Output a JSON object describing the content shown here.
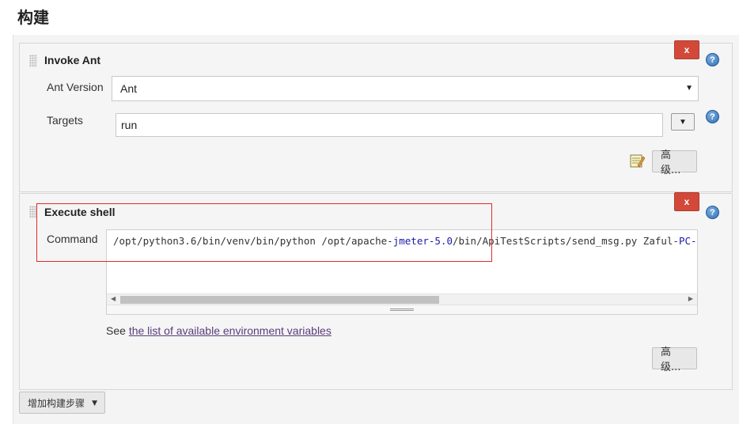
{
  "section": {
    "title": "构建"
  },
  "ant_step": {
    "title": "Invoke Ant",
    "delete_label": "x",
    "version_label": "Ant Version",
    "version_value": "Ant",
    "targets_label": "Targets",
    "targets_value": "run",
    "advanced_label": "高级..."
  },
  "shell_step": {
    "title": "Execute shell",
    "delete_label": "x",
    "command_label": "Command",
    "command_parts": {
      "p1": "/opt/python3.6/bin/venv/bin/python /opt/apache-",
      "p2": "jmeter-5.0",
      "p3": "/bin/ApiTestScripts/send_msg.py Zaful-",
      "p4": "PC-$country"
    },
    "env_prefix": "See ",
    "env_link": "the list of available environment variables",
    "advanced_label": "高级..."
  },
  "add_step": {
    "label": "增加构建步骤"
  },
  "colors": {
    "delete_red": "#d24939",
    "highlight": "#e02a2a",
    "link": "#5a3d7a"
  },
  "icons": [
    "drag-handle",
    "help-icon",
    "notepad-icon",
    "chevron-down-icon"
  ]
}
